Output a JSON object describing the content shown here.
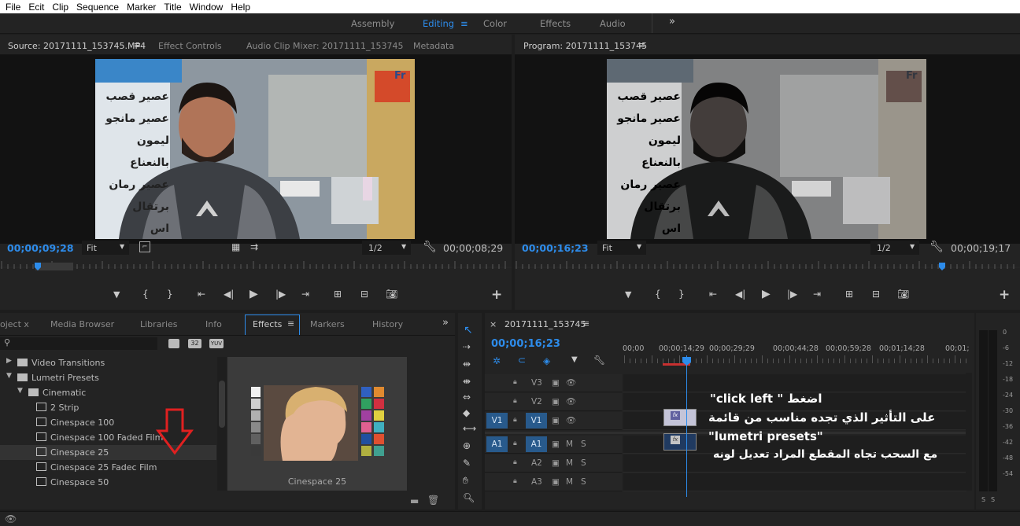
{
  "menu": [
    "File",
    "Ecit",
    "Clip",
    "Sequence",
    "Marker",
    "Title",
    "Window",
    "Help"
  ],
  "workspaces": {
    "items": [
      "Assembly",
      "Editing",
      "Color",
      "Effects",
      "Audio"
    ],
    "active": "Editing",
    "more": "»"
  },
  "source": {
    "tabs": [
      "Source: 20171111_153745.MP4",
      "Effect Controls",
      "Audio Clip Mixer: 20171111_153745",
      "Metadata"
    ],
    "timecode_left": "00;00;09;28",
    "fit": "Fit",
    "resolution": "1/2",
    "timecode_right": "00;00;08;29"
  },
  "program": {
    "tab": "Program: 20171111_153745",
    "timecode_left": "00;00;16;23",
    "fit": "Fit",
    "resolution": "1/2",
    "timecode_right": "00;00;19;17"
  },
  "video_signs": [
    "عصير قصب",
    "عصير مانجو",
    "ليمون بالنعناع",
    "عصير رمان",
    "برتقال",
    "اس"
  ],
  "video_brand": "Fr",
  "effects_panel": {
    "tabs": [
      "oject x",
      "Media Browser",
      "Libraries",
      "Info",
      "Effects",
      "Markers",
      "History"
    ],
    "active_tab": "Effects",
    "filter_buttons": [
      "32",
      "YUV"
    ],
    "tree": [
      {
        "label": "Video Transitions",
        "level": 0,
        "type": "folder"
      },
      {
        "label": "Lumetri Presets",
        "level": 0,
        "type": "folder-star",
        "open": true
      },
      {
        "label": "Cinematic",
        "level": 1,
        "type": "folder-star",
        "open": true
      },
      {
        "label": "2 Strip",
        "level": 2,
        "type": "preset"
      },
      {
        "label": "Cinespace 100",
        "level": 2,
        "type": "preset"
      },
      {
        "label": "Cinespace 100 Faded Film",
        "level": 2,
        "type": "preset"
      },
      {
        "label": "Cinespace 25",
        "level": 2,
        "type": "preset",
        "selected": true
      },
      {
        "label": "Cinespace 25 Fadec Film",
        "level": 2,
        "type": "preset"
      },
      {
        "label": "Cinespace 50",
        "level": 2,
        "type": "preset"
      }
    ],
    "preview_caption": "Cinespace 25"
  },
  "timeline": {
    "tab": "20171111_153745",
    "timecode": "00;00;16;23",
    "ruler": [
      "00;00",
      "00;00;14;29",
      "00;00;29;29",
      "00;00;44;28",
      "00;00;59;28",
      "00;01;14;28",
      "00;01;"
    ],
    "tracks": [
      {
        "src": "",
        "name": "V3",
        "type": "video"
      },
      {
        "src": "",
        "name": "V2",
        "type": "video"
      },
      {
        "src": "V1",
        "name": "V1",
        "type": "video"
      },
      {
        "src": "A1",
        "name": "A1",
        "type": "audio",
        "m": "M",
        "s": "S"
      },
      {
        "src": "",
        "name": "A2",
        "type": "audio",
        "m": "M",
        "s": "S"
      },
      {
        "src": "",
        "name": "A3",
        "type": "audio",
        "m": "M",
        "s": "S"
      }
    ],
    "clip_badge": "fx"
  },
  "meter": {
    "labels": [
      "0",
      "-6",
      "-12",
      "-18",
      "-24",
      "-30",
      "-36",
      "-42",
      "-48",
      "-54"
    ],
    "bottom": [
      "S",
      "S"
    ]
  },
  "annotation": {
    "line1": "اضغط \" click left\"",
    "line2": "على التأثير الذي تجده مناسب من قائمة",
    "line3": "\"lumetri presets\"",
    "line4": "مع السحب تجاه المقطع المراد تعديل لونه",
    "arrow_color": "#e02020"
  },
  "colors": {
    "accent": "#2d8ceb",
    "track_blue": "#285a8c",
    "playhead": "#2d8ceb"
  }
}
